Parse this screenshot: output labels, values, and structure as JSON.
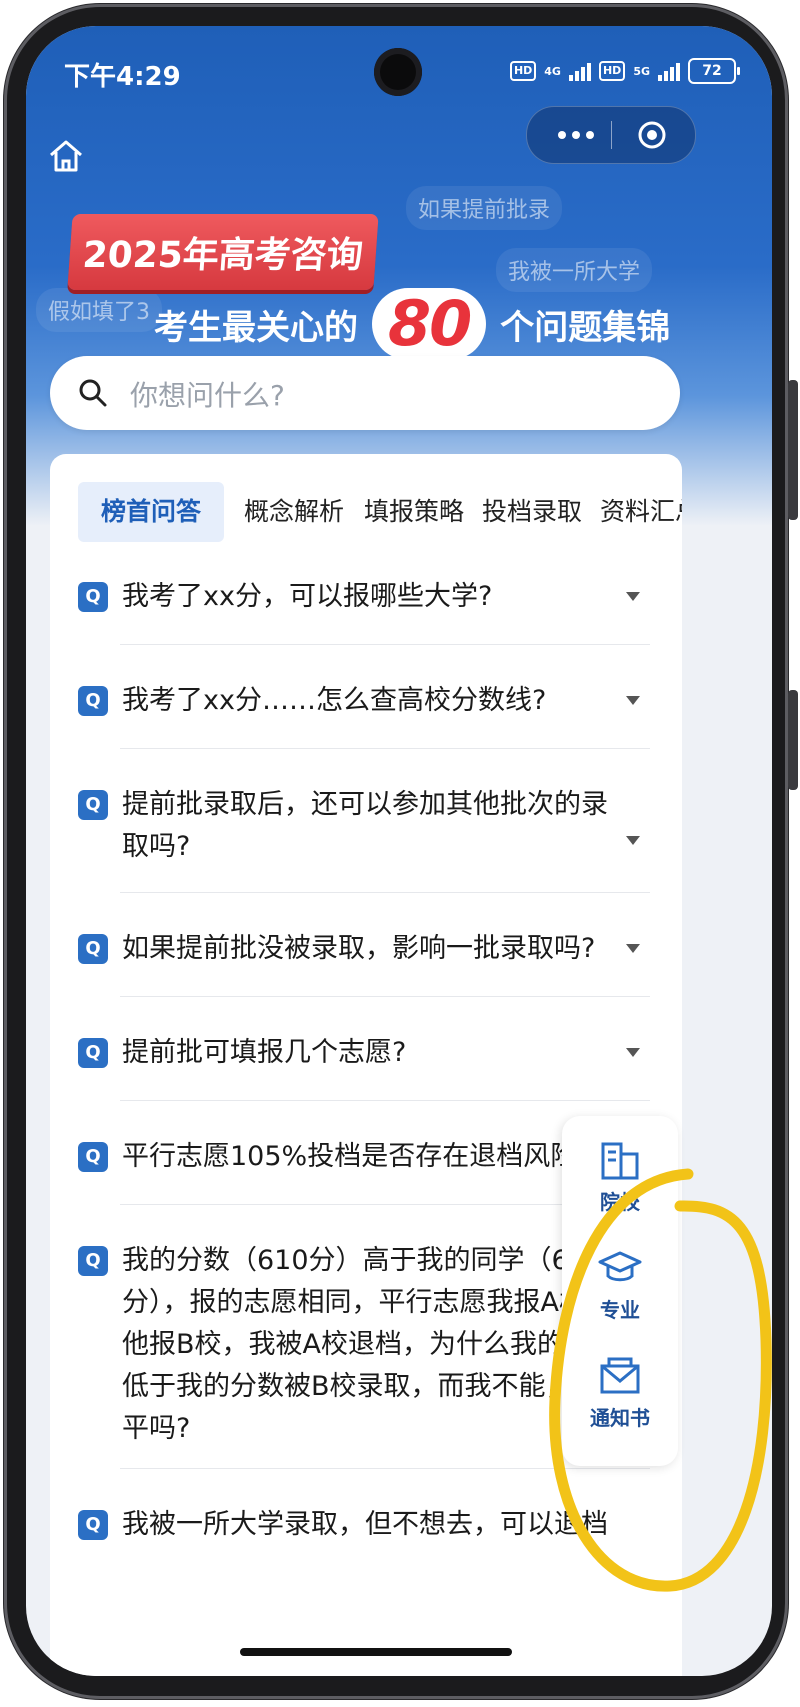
{
  "status_bar": {
    "time": "下午4:29",
    "sim1_badge": "HD",
    "sim1_network": "4G",
    "sim2_badge": "HD",
    "sim2_network": "5G",
    "battery": "72"
  },
  "top_bar": {
    "home_icon": "home-icon",
    "more_icon": "more-dots-icon",
    "close_icon": "target-icon"
  },
  "banner": {
    "tag": "2025年高考咨询",
    "headline_prefix": "考生最关心的",
    "headline_number": "80",
    "headline_suffix": "个问题集锦",
    "danmu": [
      "如果提前批录",
      "我被一所大学",
      "假如填了3"
    ]
  },
  "search": {
    "placeholder": "你想问什么?"
  },
  "tabs": [
    {
      "label": "榜首问答",
      "active": true
    },
    {
      "label": "概念解析",
      "active": false
    },
    {
      "label": "填报策略",
      "active": false
    },
    {
      "label": "投档录取",
      "active": false
    },
    {
      "label": "资料汇总",
      "active": false
    }
  ],
  "questions": [
    {
      "badge": "Q",
      "text": "我考了xx分，可以报哪些大学?"
    },
    {
      "badge": "Q",
      "text": "我考了xx分……怎么查高校分数线?"
    },
    {
      "badge": "Q",
      "text": "提前批录取后，还可以参加其他批次的录取吗?"
    },
    {
      "badge": "Q",
      "text": "如果提前批没被录取，影响一批录取吗?"
    },
    {
      "badge": "Q",
      "text": "提前批可填报几个志愿?"
    },
    {
      "badge": "Q",
      "text": "平行志愿105%投档是否存在退档风险?"
    },
    {
      "badge": "Q",
      "text": "我的分数（610分）高于我的同学（607分），报的志愿相同，平行志愿我报A校，他报B校，我被A校退档，为什么我的同学低于我的分数被B校录取，而我不能，公平吗?"
    },
    {
      "badge": "Q",
      "text": "我被一所大学录取，但不想去，可以退档"
    }
  ],
  "float_menu": [
    {
      "label": "院校",
      "icon": "building-icon"
    },
    {
      "label": "专业",
      "icon": "graduation-cap-icon"
    },
    {
      "label": "通知书",
      "icon": "envelope-icon"
    }
  ],
  "colors": {
    "primary": "#1f5fb8",
    "accent_red": "#e8333b",
    "annotation": "#f2c318"
  }
}
